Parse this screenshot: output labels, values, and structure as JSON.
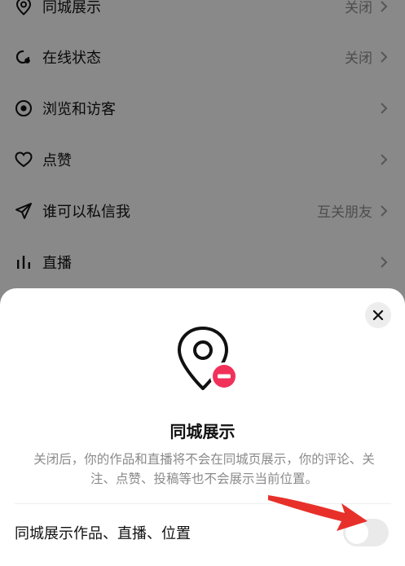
{
  "settings": {
    "items": [
      {
        "label": "同城展示",
        "value": "关闭",
        "icon": "location-pin-icon"
      },
      {
        "label": "在线状态",
        "value": "关闭",
        "icon": "online-status-icon"
      },
      {
        "label": "浏览和访客",
        "value": "",
        "icon": "eye-icon"
      },
      {
        "label": "点赞",
        "value": "",
        "icon": "heart-icon"
      },
      {
        "label": "谁可以私信我",
        "value": "互关朋友",
        "icon": "send-icon"
      },
      {
        "label": "直播",
        "value": "",
        "icon": "bars-icon"
      }
    ]
  },
  "sheet": {
    "title": "同城展示",
    "description": "关闭后，你的作品和直播将不会在同城页展示，你的评论、关注、点赞、投稿等也不会展示当前位置。",
    "toggle_label": "同城展示作品、直播、位置",
    "toggle_on": false,
    "close_icon": "close-icon",
    "hero_icon": "location-pin-minus-icon"
  },
  "colors": {
    "accent_red": "#f2315a",
    "annotation_arrow": "#e8302b"
  }
}
